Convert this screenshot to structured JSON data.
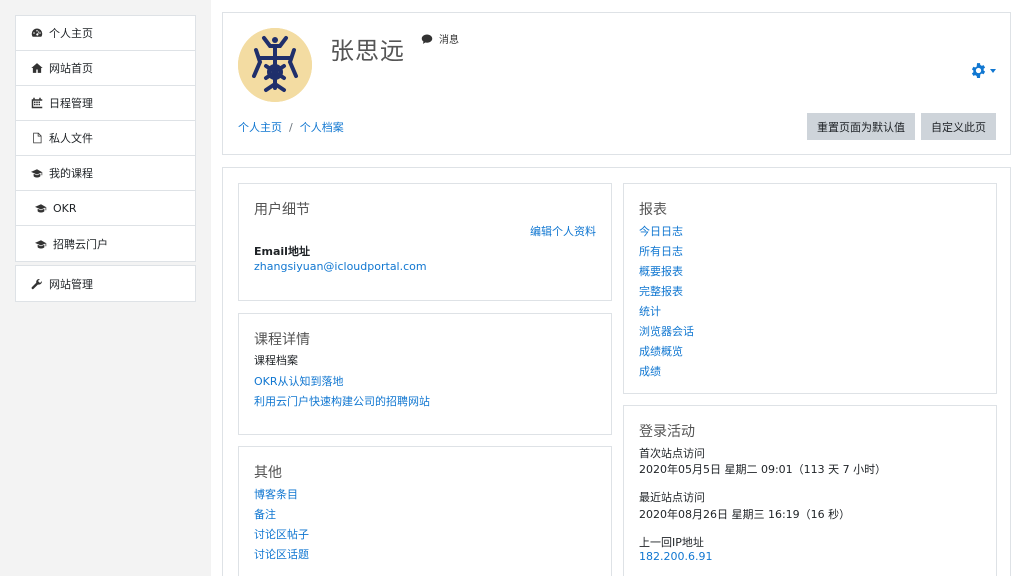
{
  "sidebar": {
    "items": [
      {
        "label": "个人主页",
        "icon": "dashboard-icon"
      },
      {
        "label": "网站首页",
        "icon": "home-icon"
      },
      {
        "label": "日程管理",
        "icon": "calendar-icon"
      },
      {
        "label": "私人文件",
        "icon": "file-icon"
      },
      {
        "label": "我的课程",
        "icon": "graduation-cap-icon"
      },
      {
        "label": "OKR",
        "icon": "graduation-cap-icon"
      },
      {
        "label": "招聘云门户",
        "icon": "graduation-cap-icon"
      }
    ],
    "admin": {
      "label": "网站管理",
      "icon": "wrench-icon"
    }
  },
  "header": {
    "user_name": "张思远",
    "message_label": "消息",
    "breadcrumb": [
      "个人主页",
      "个人档案"
    ],
    "reset_button": "重置页面为默认值",
    "customize_button": "自定义此页",
    "accent_color": "#1177d1"
  },
  "user_details": {
    "title": "用户细节",
    "edit_link": "编辑个人资料",
    "email_label": "Email地址",
    "email_value": "zhangsiyuan@icloudportal.com"
  },
  "course_details": {
    "title": "课程详情",
    "profile_label": "课程档案",
    "courses": [
      "OKR从认知到落地",
      "利用云门户快速构建公司的招聘网站"
    ]
  },
  "other": {
    "title": "其他",
    "links": [
      "博客条目",
      "备注",
      "讨论区帖子",
      "讨论区话题"
    ]
  },
  "reports": {
    "title": "报表",
    "links": [
      "今日日志",
      "所有日志",
      "概要报表",
      "完整报表",
      "统计",
      "浏览器会话",
      "成绩概览",
      "成绩"
    ]
  },
  "login_activity": {
    "title": "登录活动",
    "first_access_label": "首次站点访问",
    "first_access_value": "2020年05月5日 星期二 09:01（113 天 7 小时）",
    "last_access_label": "最近站点访问",
    "last_access_value": "2020年08月26日 星期三 16:19（16 秒）",
    "last_ip_label": "上一回IP地址",
    "last_ip_value": "182.200.6.91"
  }
}
